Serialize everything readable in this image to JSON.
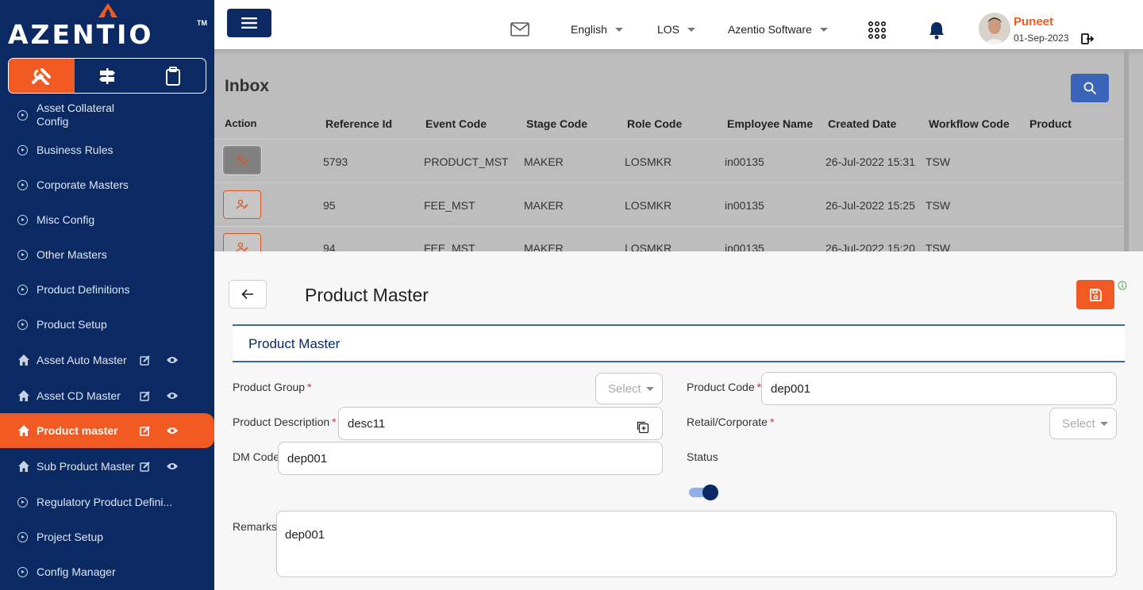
{
  "brand": {
    "logo_text": "AZENTIO",
    "logo_tm": "TM",
    "accent_color": "#f15a22",
    "navy_color": "#0b2a63"
  },
  "sidebar": {
    "mode_tabs": [
      {
        "icon": "tools-icon",
        "active": true
      },
      {
        "icon": "signpost-icon",
        "active": false
      },
      {
        "icon": "clipboard-icon",
        "active": false
      }
    ],
    "items": [
      {
        "label": "Asset Collateral Config"
      },
      {
        "label": "Business Rules"
      },
      {
        "label": "Corporate Masters"
      },
      {
        "label": "Misc Config"
      },
      {
        "label": "Other Masters"
      },
      {
        "label": "Product Definitions"
      },
      {
        "label": "Product Setup"
      },
      {
        "label": "Asset Auto Master"
      },
      {
        "label": "Asset CD Master"
      },
      {
        "label": "Product master"
      },
      {
        "label": "Sub Product Master"
      },
      {
        "label": "Regulatory Product Defini..."
      },
      {
        "label": "Project Setup"
      },
      {
        "label": "Config Manager"
      }
    ],
    "active_item": "Product master"
  },
  "header": {
    "language": "English",
    "module": "LOS",
    "company": "Azentio Software",
    "user_name": "Puneet",
    "date": "01-Sep-2023"
  },
  "inbox": {
    "title": "Inbox",
    "columns": [
      "Action",
      "Reference Id",
      "Event Code",
      "Stage Code",
      "Role Code",
      "Employee Name",
      "Created Date",
      "Workflow Code",
      "Product"
    ],
    "rows": [
      {
        "ref": "5793",
        "event": "PRODUCT_MST",
        "stage": "MAKER",
        "role": "LOSMKR",
        "employee": "in00135",
        "created": "26-Jul-2022 15:31",
        "workflow": "TSW",
        "product": ""
      },
      {
        "ref": "95",
        "event": "FEE_MST",
        "stage": "MAKER",
        "role": "LOSMKR",
        "employee": "in00135",
        "created": "26-Jul-2022 15:25",
        "workflow": "TSW",
        "product": ""
      },
      {
        "ref": "94",
        "event": "FEE_MST",
        "stage": "MAKER",
        "role": "LOSMKR",
        "employee": "in00135",
        "created": "26-Jul-2022 15:20",
        "workflow": "TSW",
        "product": ""
      }
    ]
  },
  "form": {
    "title": "Product Master",
    "section_title": "Product Master",
    "product_group": {
      "label": "Product Group",
      "placeholder": "Select"
    },
    "product_code": {
      "label": "Product Code",
      "value": "dep001"
    },
    "product_description": {
      "label": "Product Description",
      "value": "desc11"
    },
    "retail_corporate": {
      "label": "Retail/Corporate",
      "placeholder": "Select"
    },
    "dm_code": {
      "label": "DM Code",
      "value": "dep001"
    },
    "status": {
      "label": "Status",
      "enabled": true
    },
    "remarks": {
      "label": "Remarks",
      "value": "dep001"
    },
    "required_mark": "*"
  }
}
